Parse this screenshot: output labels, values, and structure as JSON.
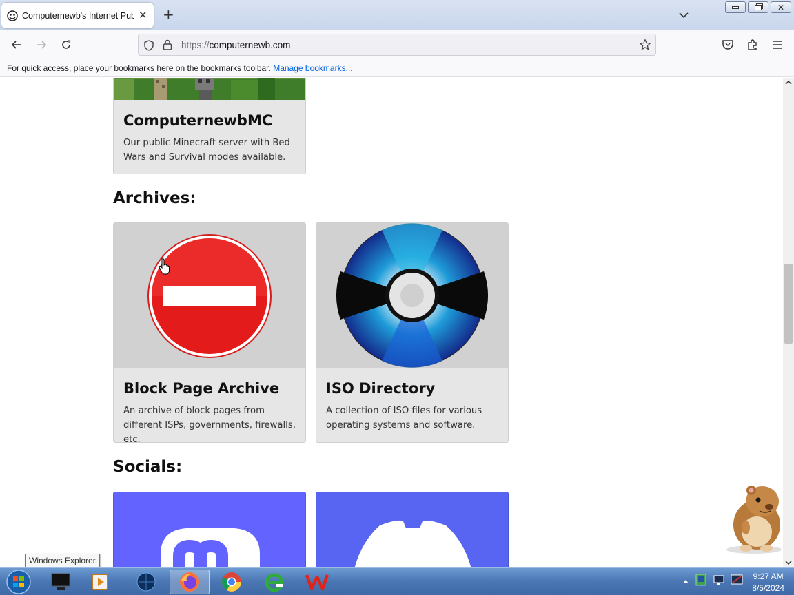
{
  "browser": {
    "tab_title": "Computernewb's Internet Pub",
    "url_scheme": "https://",
    "url_host": "computernewb.com",
    "bookmarks_text": "For quick access, place your bookmarks here on the bookmarks toolbar.",
    "bookmarks_link": "Manage bookmarks..."
  },
  "page": {
    "top_card": {
      "title": "ComputernewbMC",
      "desc": "Our public Minecraft server with Bed Wars and Survival modes available."
    },
    "archives_heading": "Archives:",
    "archives": [
      {
        "title": "Block Page Archive",
        "desc": "An archive of block pages from different ISPs, governments, firewalls, etc.",
        "icon": "no-entry-icon"
      },
      {
        "title": "ISO Directory",
        "desc": "A collection of ISO files for various operating systems and software.",
        "icon": "disc-icon"
      }
    ],
    "socials_heading": "Socials:",
    "socials": [
      {
        "icon": "mastodon-icon",
        "color": "#6364ff"
      },
      {
        "icon": "discord-icon",
        "color": "#5865f2"
      }
    ]
  },
  "tooltip": "Windows Explorer",
  "taskbar": {
    "time": "9:27 AM",
    "date": "8/5/2024"
  }
}
